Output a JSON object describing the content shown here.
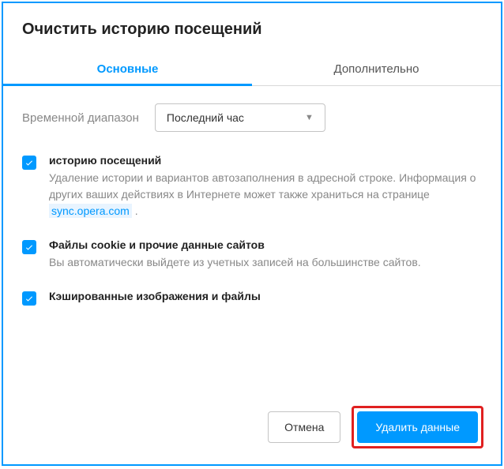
{
  "dialog": {
    "title": "Очистить историю посещений"
  },
  "tabs": {
    "basic": "Основные",
    "advanced": "Дополнительно"
  },
  "timeRange": {
    "label": "Временной диапазон",
    "selected": "Последний час"
  },
  "options": {
    "history": {
      "title": "историю посещений",
      "desc1": "Удаление истории и вариантов автозаполнения в адресной строке. Информация о других ваших действиях в Интернете может также храниться на странице ",
      "link": "sync.opera.com",
      "desc2": " ."
    },
    "cookies": {
      "title": "Файлы cookie и прочие данные сайтов",
      "desc": "Вы автоматически выйдете из учетных записей на большинстве сайтов."
    },
    "cache": {
      "title": "Кэшированные изображения и файлы"
    }
  },
  "buttons": {
    "cancel": "Отмена",
    "clear": "Удалить данные"
  }
}
